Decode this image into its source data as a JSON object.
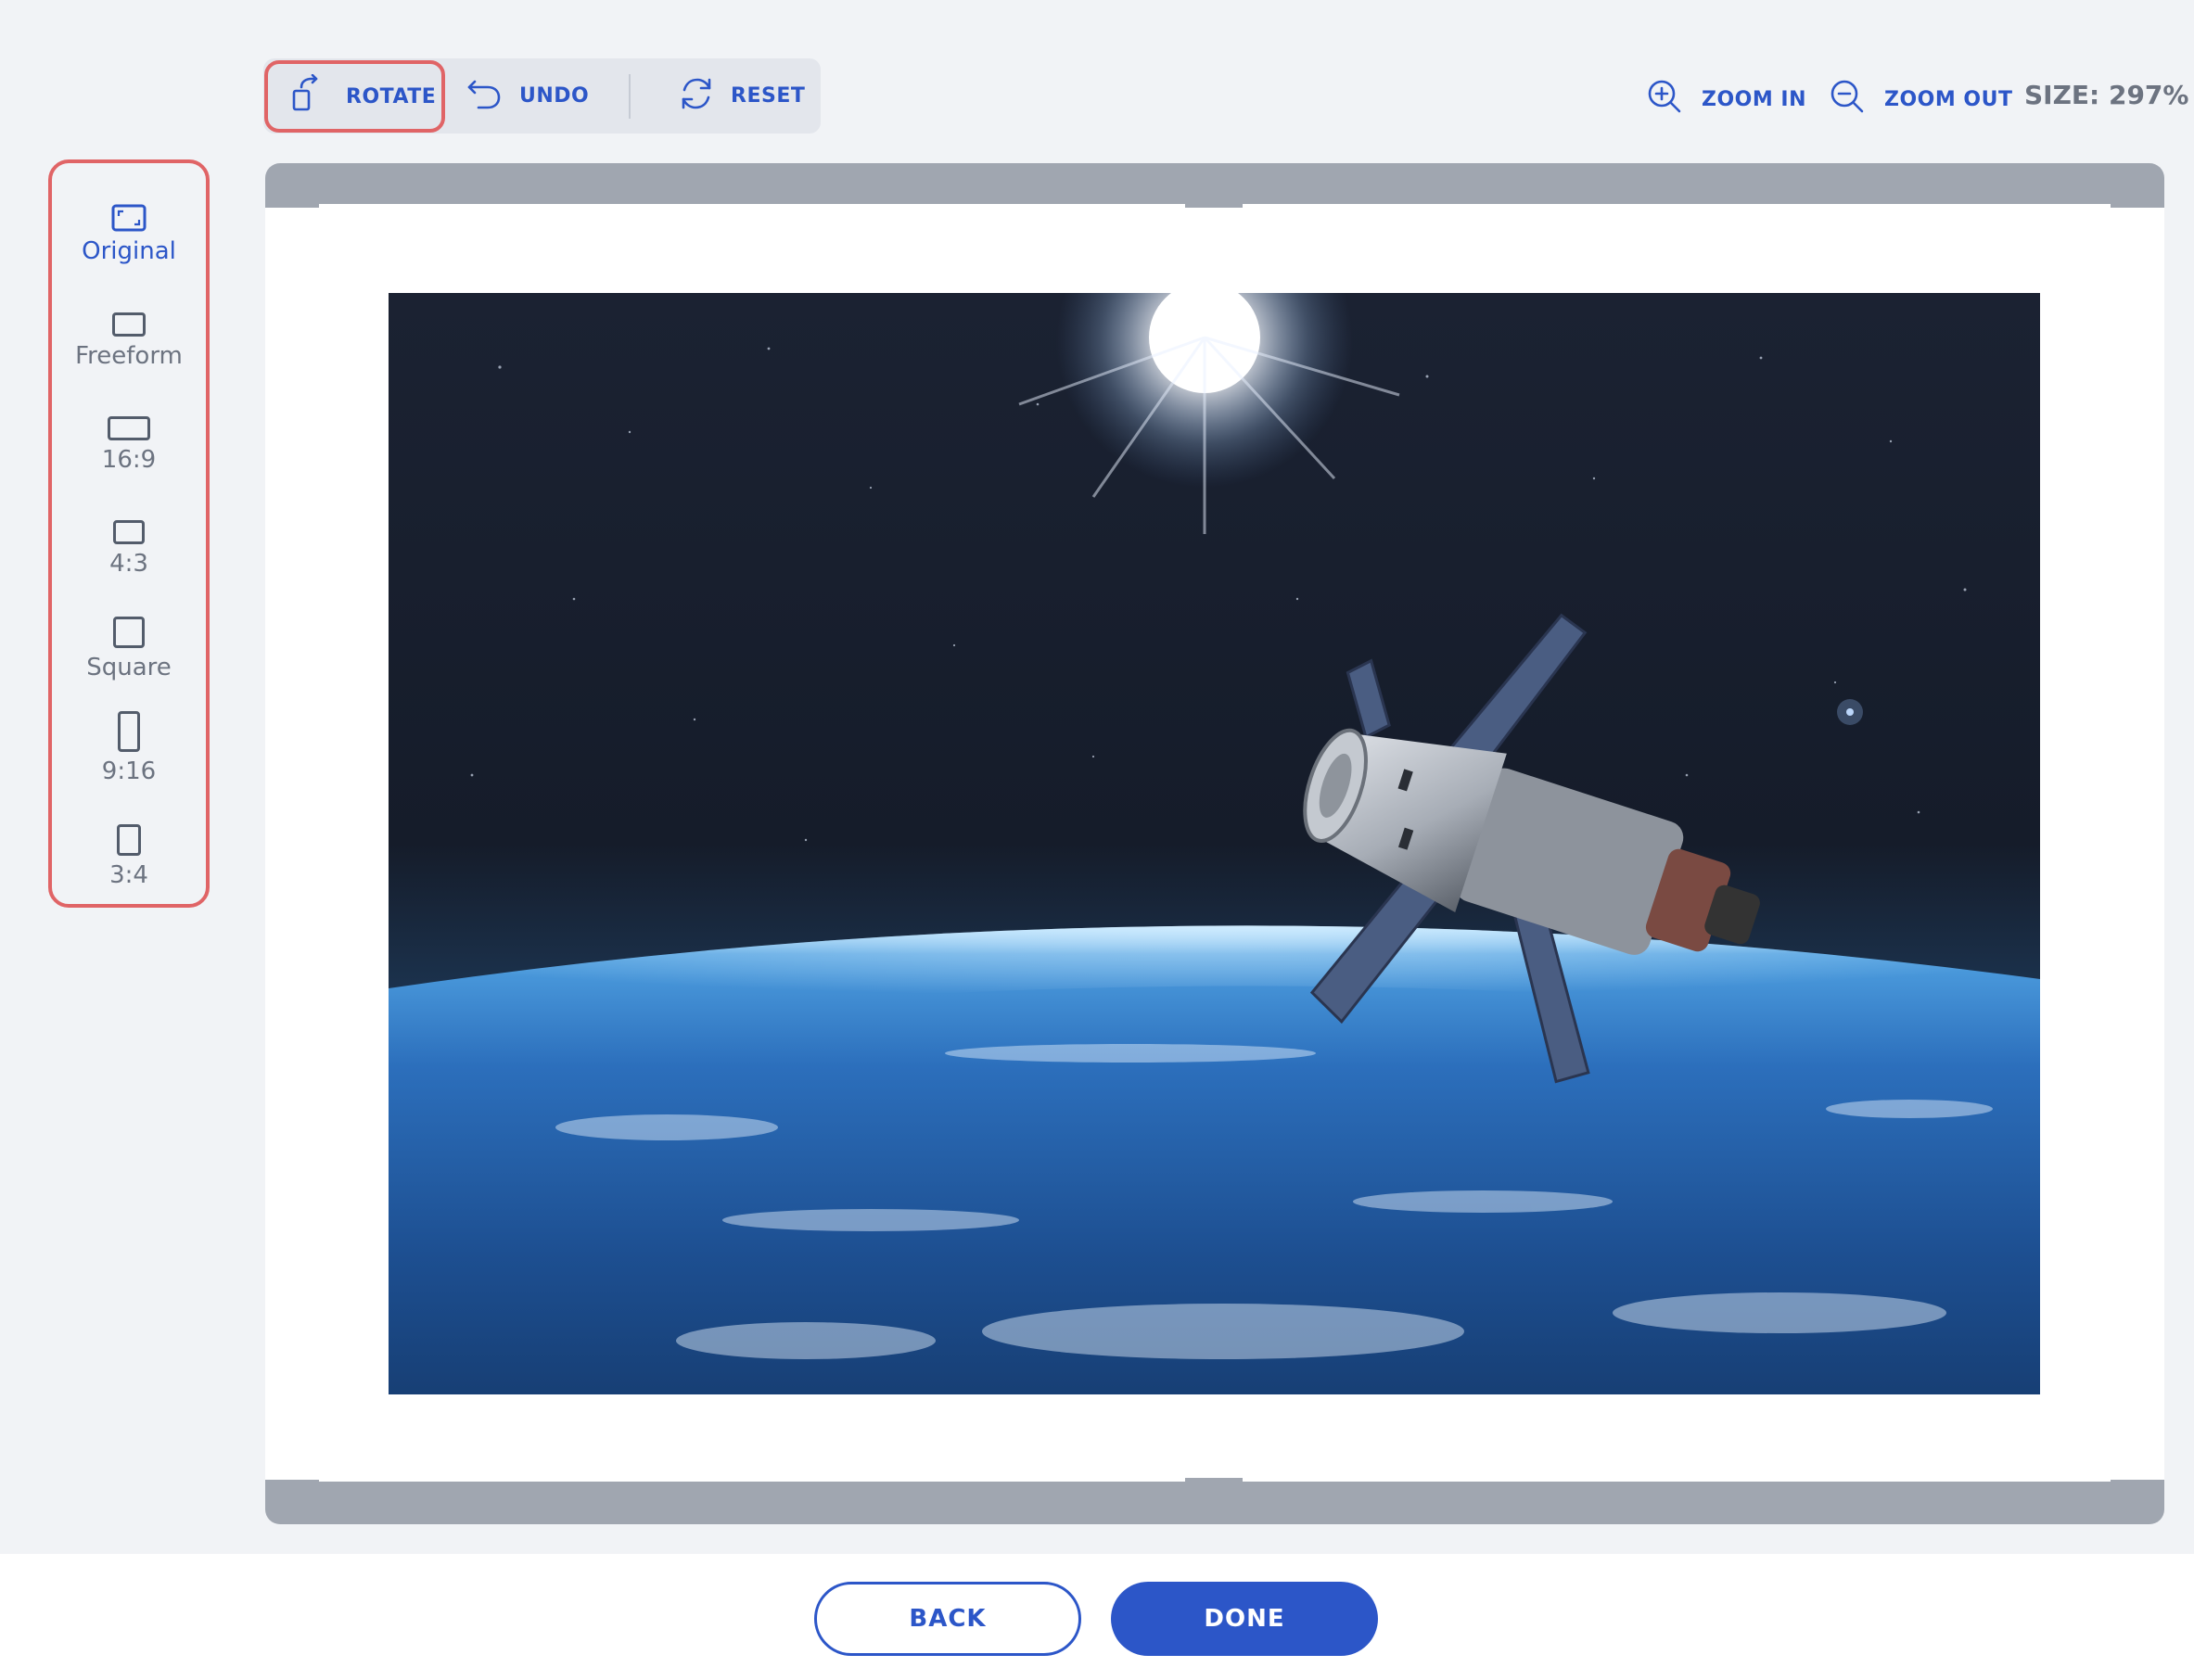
{
  "toolbar": {
    "rotate_label": "ROTATE",
    "undo_label": "UNDO",
    "reset_label": "RESET",
    "zoom_in_label": "ZOOM IN",
    "zoom_out_label": "ZOOM OUT",
    "size_readout": "SIZE: 297%"
  },
  "icons": {
    "rotate": "rotate-icon",
    "undo": "undo-icon",
    "reset": "reset-icon",
    "zoom_in": "zoom-in-icon",
    "zoom_out": "zoom-out-icon"
  },
  "aspect_ratios": {
    "selected": "Original",
    "items": [
      {
        "label": "Original"
      },
      {
        "label": "Freeform"
      },
      {
        "label": "16:9"
      },
      {
        "label": "4:3"
      },
      {
        "label": "Square"
      },
      {
        "label": "9:16"
      },
      {
        "label": "3:4"
      }
    ]
  },
  "footer": {
    "back_label": "BACK",
    "done_label": "DONE"
  },
  "colors": {
    "accent": "#2c56c8",
    "highlight": "#e06466",
    "background": "#f1f3f6",
    "canvas_border": "#a0a6b0"
  }
}
